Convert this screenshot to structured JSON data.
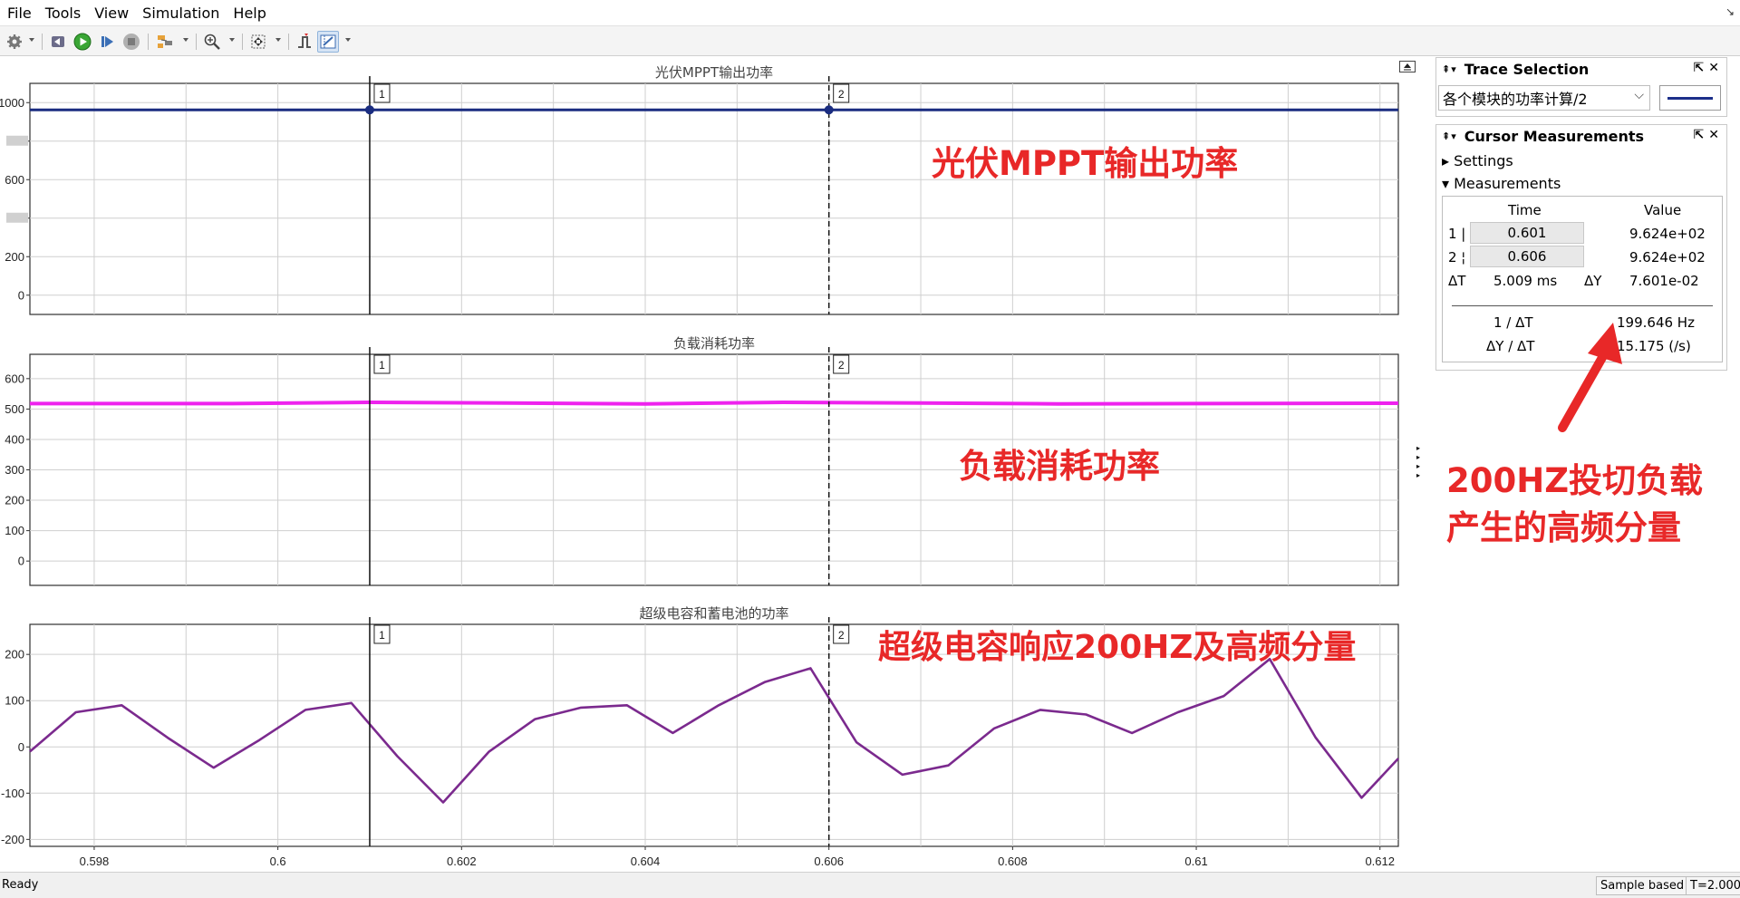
{
  "menu": [
    "File",
    "Tools",
    "View",
    "Simulation",
    "Help"
  ],
  "toolbar": {
    "icons": [
      "settings-icon",
      "step-back-icon",
      "run-icon",
      "step-forward-icon",
      "stop-icon",
      "highlight-icon",
      "zoom-in-icon",
      "fit-axes-icon",
      "triggers-icon",
      "cursor-measurements-icon"
    ]
  },
  "plots": [
    {
      "title": "光伏MPPT输出功率",
      "ylim": [
        -100,
        1100
      ],
      "yticks": [
        0,
        200,
        400,
        600,
        800,
        1000
      ],
      "yticklabels": [
        "0",
        "200",
        "",
        "600",
        "",
        "1000"
      ],
      "color": "#1a2c80",
      "series_name": "各个模块的功率计算/2",
      "values": [
        962.4,
        962.4
      ]
    },
    {
      "title": "负载消耗功率",
      "ylim": [
        -80,
        680
      ],
      "yticks": [
        0,
        100,
        200,
        300,
        400,
        500,
        600
      ],
      "yticklabels": [
        "0",
        "100",
        "200",
        "300",
        "400",
        "500",
        "600"
      ],
      "color": "#ee22ee"
    },
    {
      "title": "超级电容和蓄电池的功率",
      "ylim": [
        -215,
        265
      ],
      "yticks": [
        -200,
        -100,
        0,
        100,
        200
      ],
      "yticklabels": [
        "-200",
        "-100",
        "0",
        "100",
        "200"
      ],
      "color": "#7b2a8e"
    }
  ],
  "xaxis": {
    "xlim": [
      0.5973,
      0.6122
    ],
    "ticks": [
      0.598,
      0.6,
      0.602,
      0.604,
      0.606,
      0.608,
      0.61,
      0.612
    ],
    "ticklabels": [
      "0.598",
      "0.6",
      "0.602",
      "0.604",
      "0.606",
      "0.608",
      "0.61",
      "0.612"
    ],
    "minor_ticks": [
      0.599,
      0.601,
      0.603,
      0.605,
      0.607,
      0.609,
      0.611
    ]
  },
  "chart_data": [
    {
      "type": "line",
      "title": "光伏MPPT输出功率",
      "series": [
        {
          "name": "各个模块的功率计算/2",
          "x": [
            0.5973,
            0.6122
          ],
          "y": [
            962.4,
            962.4
          ]
        }
      ],
      "xlim": [
        0.5973,
        0.6122
      ],
      "ylim": [
        -100,
        1100
      ]
    },
    {
      "type": "line",
      "title": "负载消耗功率",
      "series": [
        {
          "x": [
            0.5973,
            0.5995,
            0.601,
            0.6025,
            0.604,
            0.6055,
            0.607,
            0.6085,
            0.61,
            0.6122
          ],
          "y": [
            518,
            518,
            522,
            520,
            517,
            522,
            520,
            517,
            518,
            519
          ]
        }
      ],
      "xlim": [
        0.5973,
        0.6122
      ],
      "ylim": [
        -80,
        680
      ]
    },
    {
      "type": "line",
      "title": "超级电容和蓄电池的功率",
      "series": [
        {
          "x": [
            0.5973,
            0.5978,
            0.5983,
            0.5988,
            0.5993,
            0.5998,
            0.6003,
            0.6008,
            0.6013,
            0.6018,
            0.6023,
            0.6028,
            0.6033,
            0.6038,
            0.6043,
            0.6048,
            0.6053,
            0.6058,
            0.6063,
            0.6068,
            0.6073,
            0.6078,
            0.6083,
            0.6088,
            0.6093,
            0.6098,
            0.6103,
            0.6108,
            0.6113,
            0.6118,
            0.6122
          ],
          "y": [
            -10,
            75,
            90,
            20,
            -45,
            15,
            80,
            95,
            -20,
            -120,
            -10,
            60,
            85,
            90,
            30,
            90,
            140,
            170,
            10,
            -60,
            -40,
            40,
            80,
            70,
            30,
            75,
            110,
            190,
            20,
            -110,
            -25
          ]
        }
      ],
      "xlim": [
        0.5973,
        0.6122
      ],
      "ylim": [
        -215,
        265
      ]
    }
  ],
  "cursors": [
    {
      "label": "1",
      "x": 0.601,
      "style": "solid"
    },
    {
      "label": "2",
      "x": 0.606,
      "style": "dashed"
    }
  ],
  "trace_selection": {
    "title": "Trace Selection",
    "selected": "各个模块的功率计算/2",
    "line_color": "#1c2f8a"
  },
  "cursor_measurements": {
    "title": "Cursor Measurements",
    "settings_label": "Settings",
    "measurements_label": "Measurements",
    "col_time": "Time",
    "col_value": "Value",
    "row1_label": "1 |",
    "row1_time": "0.601",
    "row1_value": "9.624e+02",
    "row2_label": "2 ¦",
    "row2_time": "0.606",
    "row2_value": "9.624e+02",
    "dt_label": "ΔT",
    "dt_value": "5.009 ms",
    "dy_label": "ΔY",
    "dy_value": "7.601e-02",
    "inv_dt_label": "1 / ΔT",
    "inv_dt_value": "199.646 Hz",
    "dydt_label": "ΔY / ΔT",
    "dydt_value": "15.175 (/s)"
  },
  "annotations": {
    "a1": "光伏MPPT输出功率",
    "a2": "负载消耗功率",
    "a3": "超级电容响应200HZ及高频分量",
    "a4_line1": "200HZ投切负载",
    "a4_line2": "产生的高频分量",
    "arrow_color": "#e82828"
  },
  "status": {
    "text": "Ready",
    "mode": "Sample based",
    "time": "T=2.000"
  }
}
